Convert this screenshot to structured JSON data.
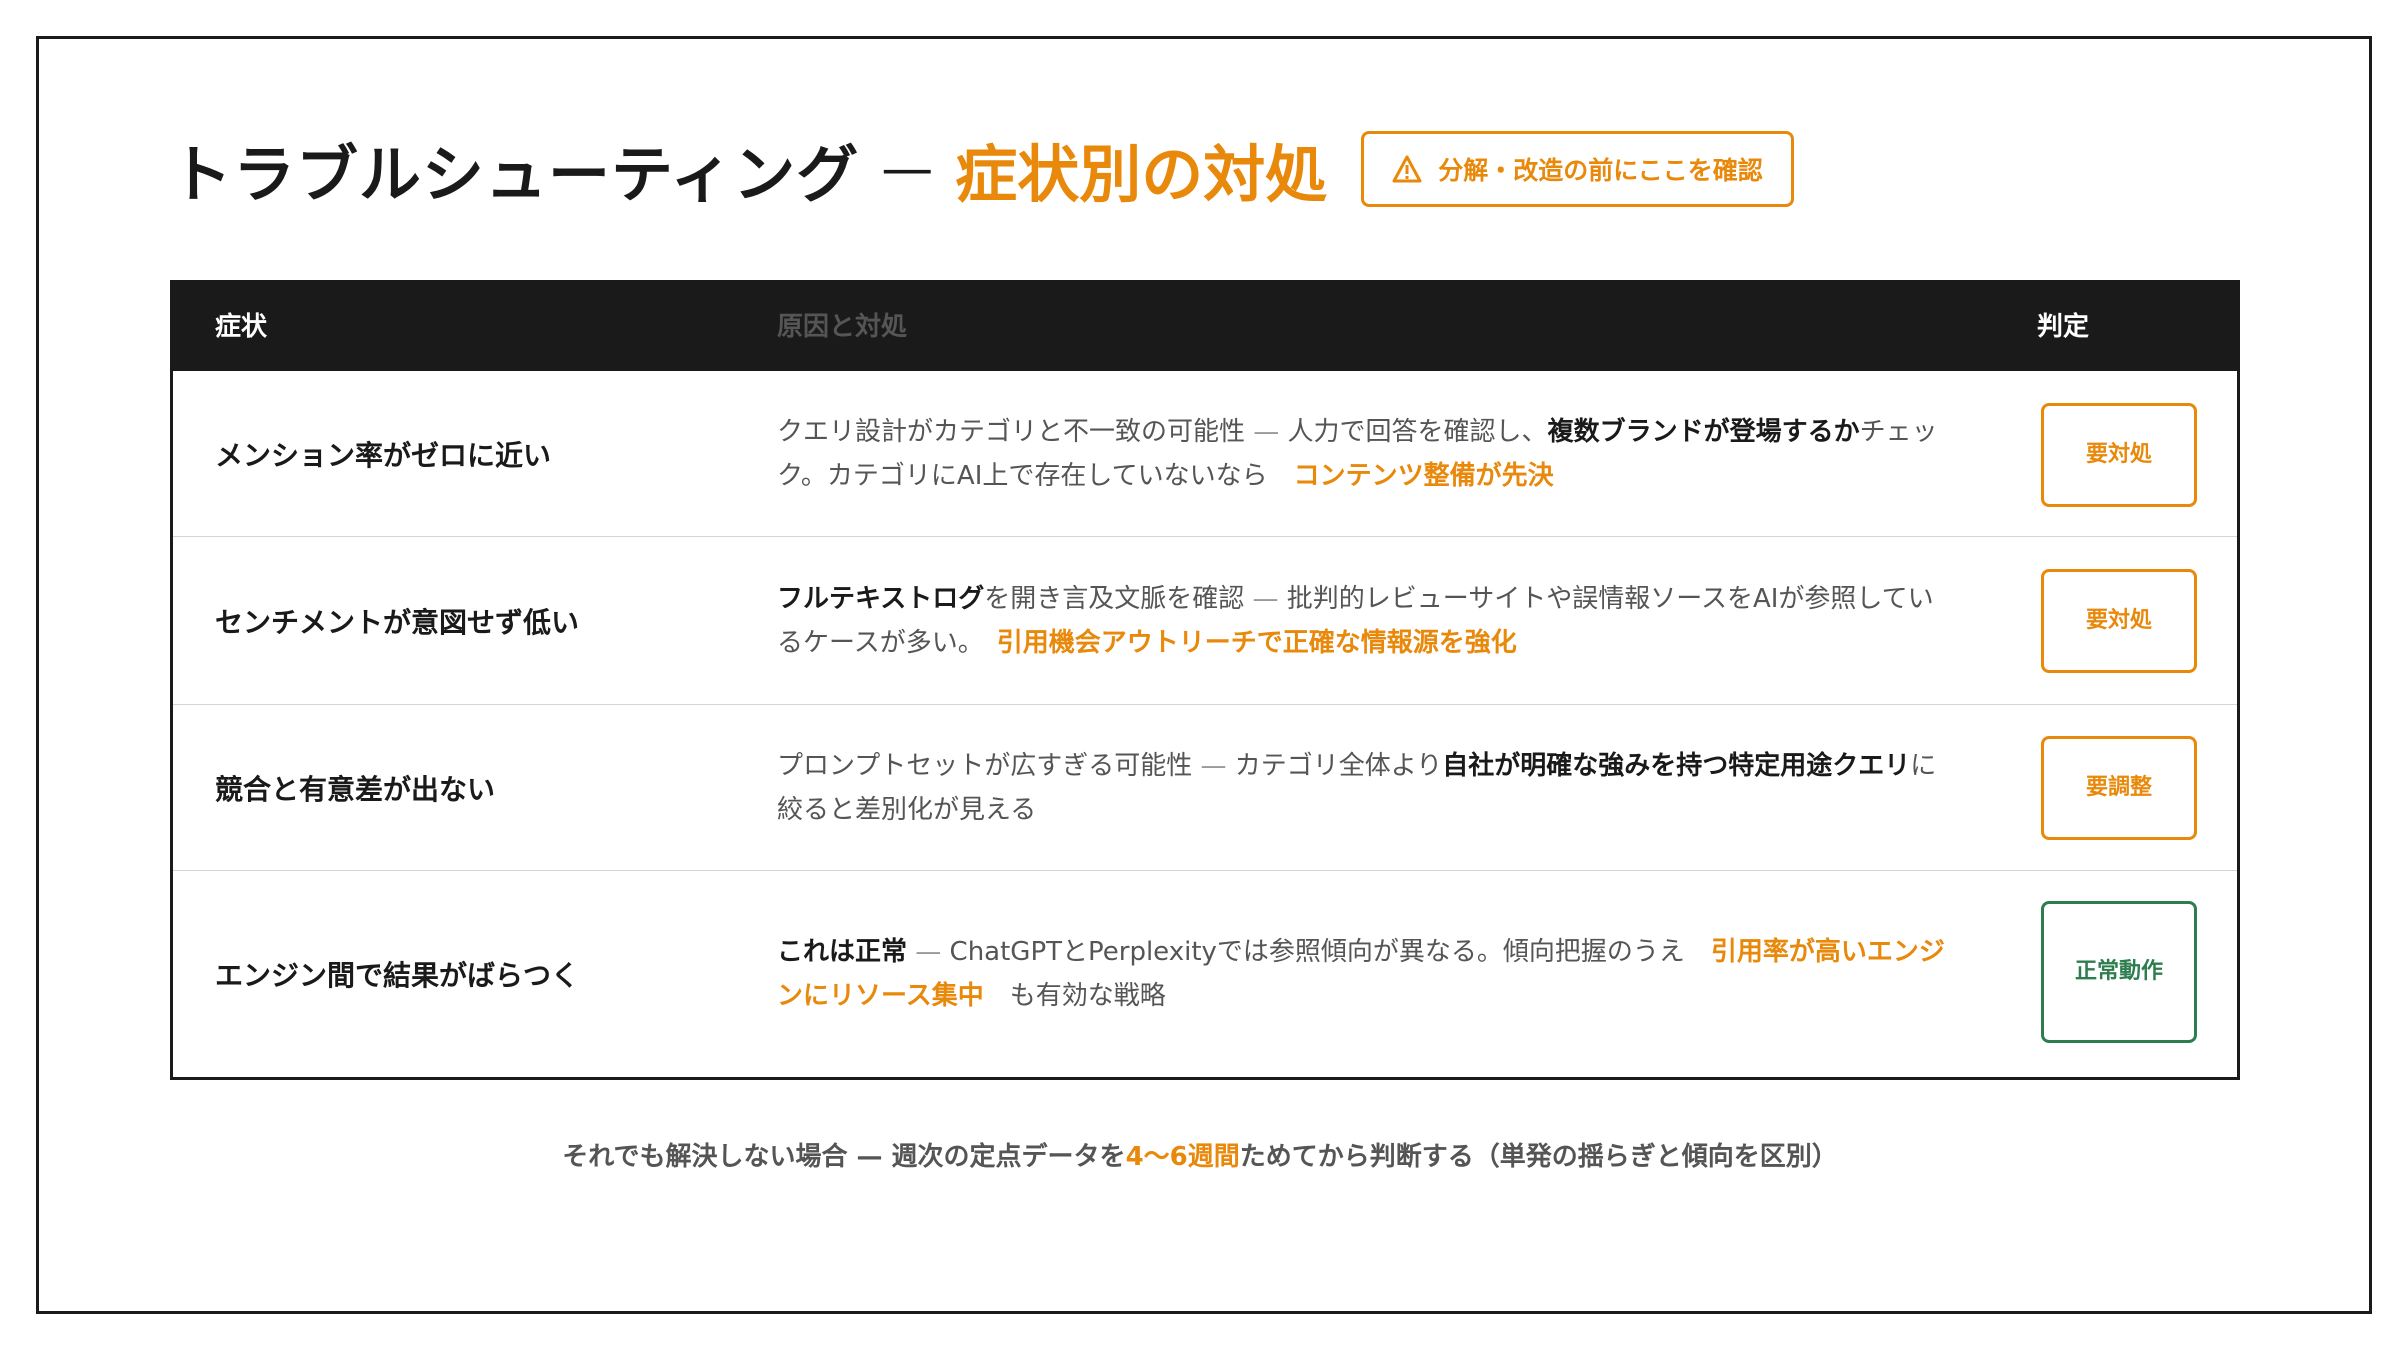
{
  "header": {
    "title": "トラブルシューティング",
    "separator": "—",
    "title_accent": "症状別の対処",
    "badge_icon": "warning-triangle-icon",
    "badge_label": "分解・改造の前にここを確認"
  },
  "table": {
    "columns": {
      "symptom": "症状",
      "cause": "原因と対処",
      "judgement": "判定"
    },
    "rows": [
      {
        "symptom": "メンション率がゼロに近い",
        "cause": {
          "p1": "クエリ設計がカテゴリと不一致の可能性",
          "dash": " — ",
          "p2": "人力で回答を確認し、",
          "p3": "複数ブランドが登場するか",
          "p4": "チェック。カテゴリにAI上で存在していないなら　",
          "p5": "コンテンツ整備が先決"
        },
        "verdict": "要対処"
      },
      {
        "symptom": "センチメントが意図せず低い",
        "cause": {
          "p1": "フルテキストログ",
          "p2": "を開き言及文脈を確認",
          "dash": " — ",
          "p3": "批判的レビューサイトや誤情報ソースをAIが参照しているケースが多い。　",
          "p4": "引用機会アウトリーチで正確な情報源を強化"
        },
        "verdict": "要対処"
      },
      {
        "symptom": "競合と有意差が出ない",
        "cause": {
          "p1": "プロンプトセットが広すぎる可能性",
          "dash": " — ",
          "p2": "カテゴリ全体より",
          "p3": "自社が明確な強みを持つ特定用途クエリ",
          "p4": "に絞ると差別化が見える"
        },
        "verdict": "要調整"
      },
      {
        "symptom": "エンジン間で結果がばらつく",
        "cause": {
          "p1": "これは正常",
          "dash": " — ",
          "p2": "ChatGPTとPerplexityでは参照傾向が異なる。傾向把握のうえ　",
          "p3": "引用率が高いエンジンにリソース集中",
          "p4": "　も有効な戦略"
        },
        "verdict": "正常動作"
      }
    ]
  },
  "footer": {
    "p1": "それでも解決しない場合 — 週次の定点データを",
    "p2": "4〜6週間",
    "p3": "ためてから判断する（単発の揺らぎと傾向を区別）"
  },
  "colors": {
    "accent": "#e8890c",
    "ok": "#2e7d4f",
    "header_bg": "#1a1a1a"
  }
}
